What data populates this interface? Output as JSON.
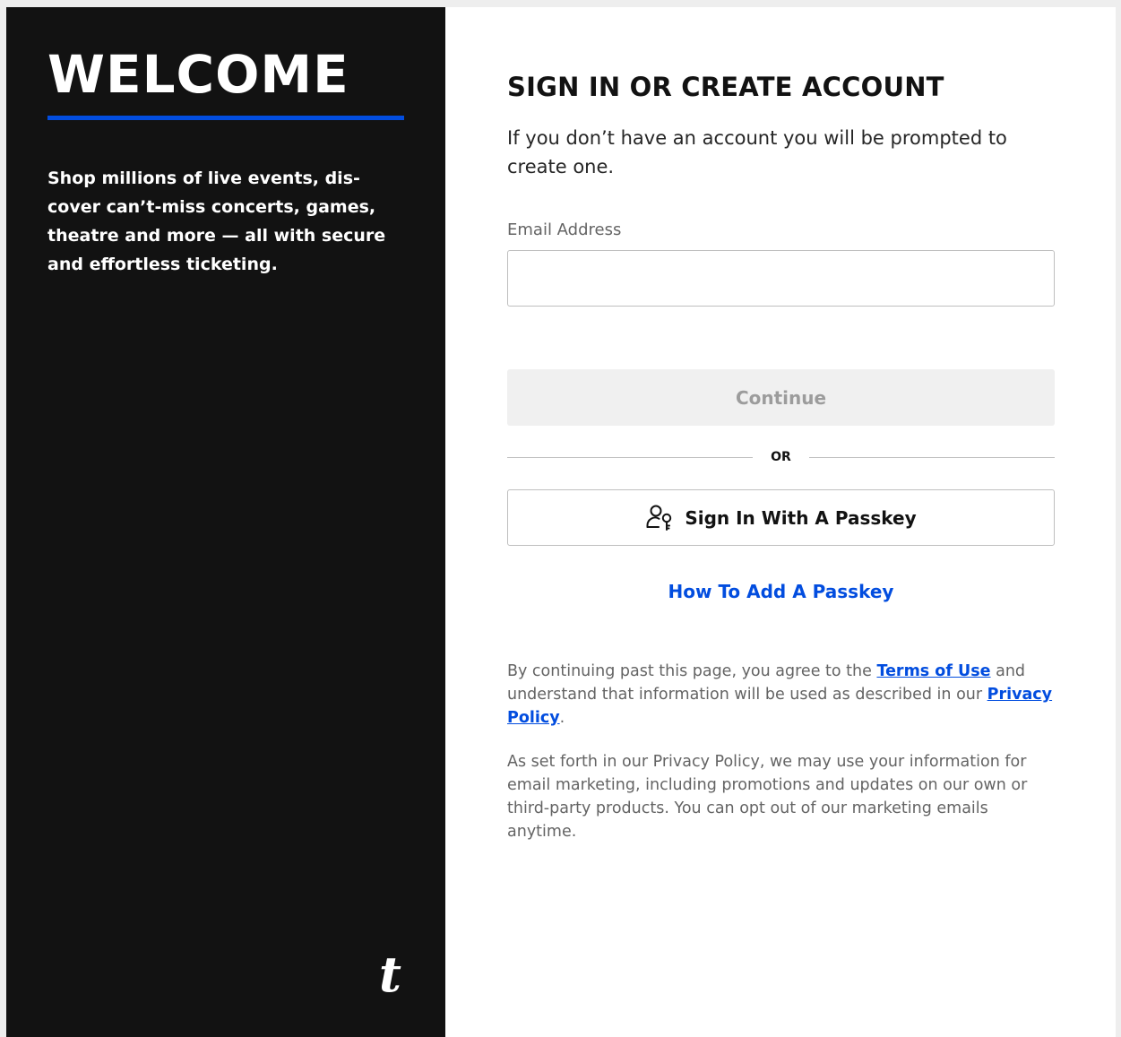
{
  "welcome_panel": {
    "title": "WELCOME",
    "tagline": "Shop millions of live events, dis-cover can’t-miss concerts, games, theatre and more — all with secure and effortless ticketing.",
    "logo_letter": "t"
  },
  "form": {
    "heading": "SIGN IN OR CREATE ACCOUNT",
    "subtext": "If you don’t have an account you will be prompted to create one.",
    "email_label": "Email Address",
    "email_value": "",
    "continue_label": "Continue",
    "or_label": "OR",
    "passkey_button_label": "Sign In With A Passkey",
    "passkey_icon": "user-key-icon",
    "how_to_link": "How To Add A Passkey"
  },
  "legal": {
    "para1_prefix": "By continuing past this page, you agree to the ",
    "terms_link": "Terms of Use",
    "para1_middle": " and understand that information will be used as described in our ",
    "privacy_link": "Privacy Policy",
    "para1_suffix": ".",
    "para2": "As set forth in our Privacy Policy, we may use your information for email marketing, including promotions and updates on our own or third-party products. You can opt out of our marketing emails anytime."
  },
  "colors": {
    "accent": "#024ddf",
    "panel_dark": "#121212",
    "disabled_bg": "#f0f0f0"
  }
}
